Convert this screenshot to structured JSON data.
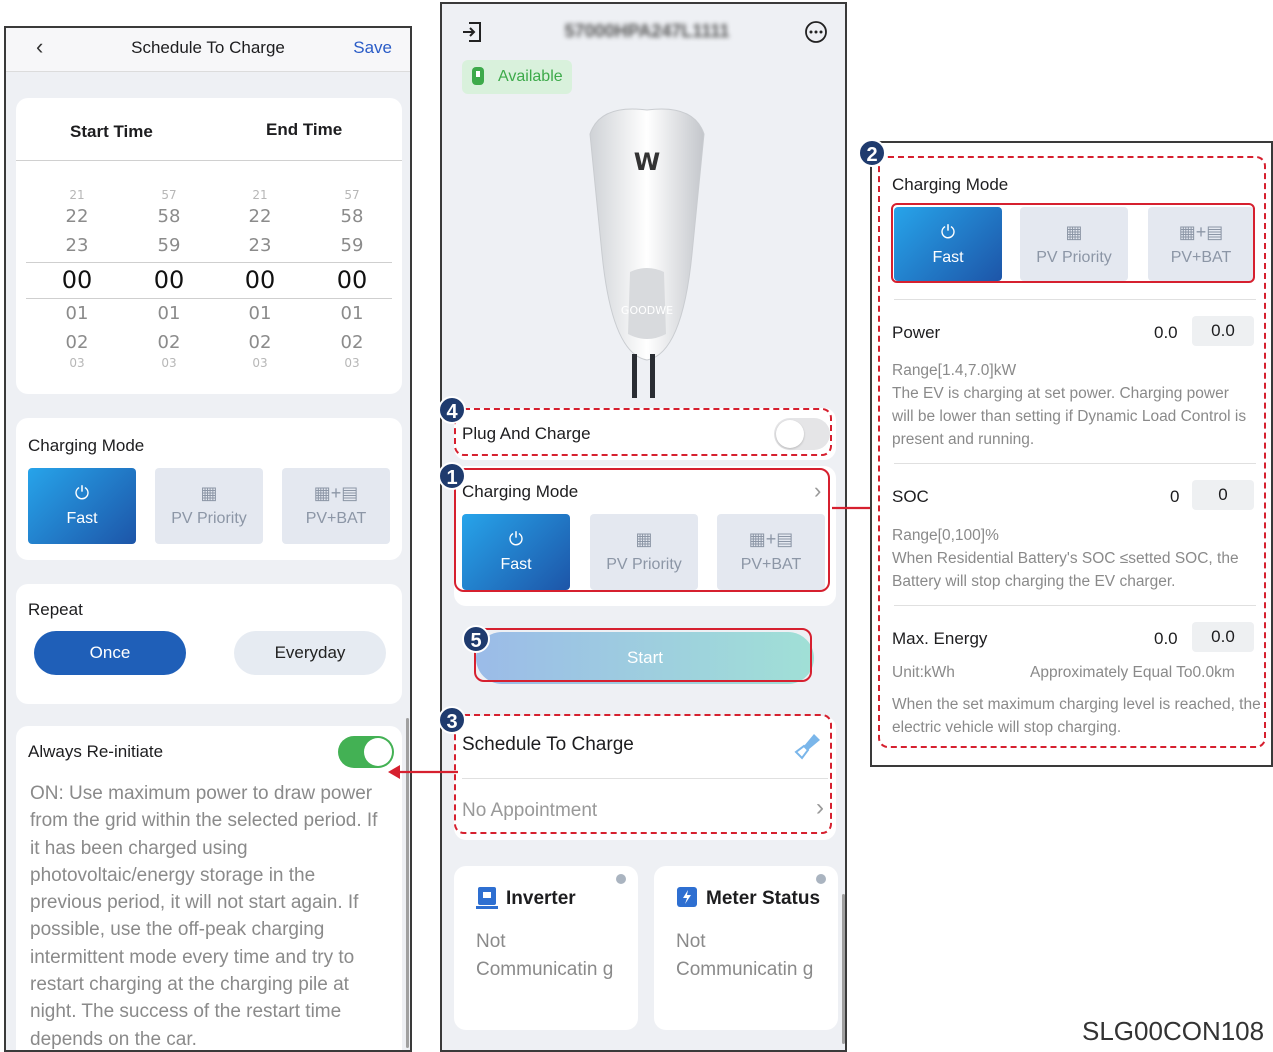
{
  "left": {
    "nav": {
      "back": "‹",
      "title": "Schedule To Charge",
      "save": "Save"
    },
    "picker": {
      "start_label": "Start Time",
      "end_label": "End Time",
      "rows_xs_top": [
        "21",
        "57",
        "21",
        "57"
      ],
      "rows_1": [
        "22",
        "58",
        "22",
        "58"
      ],
      "rows_2": [
        "23",
        "59",
        "23",
        "59"
      ],
      "selected": [
        "00",
        "00",
        "00",
        "00"
      ],
      "rows_3": [
        "01",
        "01",
        "01",
        "01"
      ],
      "rows_4": [
        "02",
        "02",
        "02",
        "02"
      ],
      "rows_xs_bottom": [
        "03",
        "03",
        "03",
        "03"
      ]
    },
    "charging_mode": {
      "title": "Charging Mode",
      "fast": "Fast",
      "pv": "PV Priority",
      "pvbat": "PV+BAT"
    },
    "repeat": {
      "title": "Repeat",
      "once": "Once",
      "everyday": "Everyday"
    },
    "reinit": {
      "title": "Always Re-initiate",
      "desc": "ON: Use maximum power to draw power from the grid within the selected period. If it has been charged using photovoltaic/energy storage in the previous period, it will not start again. If possible, use the off-peak charging intermittent mode every time and try to restart charging at the charging pile at night. The success of the restart time depends on the car."
    }
  },
  "mid": {
    "device_id": "57000HPA247L1111",
    "status": "Available",
    "brand": "GOODWE",
    "plug_and_charge": "Plug And Charge",
    "charging_mode": {
      "title": "Charging Mode",
      "fast": "Fast",
      "pv": "PV Priority",
      "pvbat": "PV+BAT"
    },
    "start": "Start",
    "schedule": {
      "title": "Schedule To Charge",
      "value": "No Appointment"
    },
    "inverter": {
      "title": "Inverter",
      "value": "Not Communicatin g"
    },
    "meter": {
      "title": "Meter Status",
      "value": "Not Communicatin g"
    }
  },
  "right": {
    "charging_mode": {
      "title": "Charging Mode",
      "fast": "Fast",
      "pv": "PV Priority",
      "pvbat": "PV+BAT"
    },
    "power": {
      "label": "Power",
      "value": "0.0",
      "input": "0.0",
      "range": "Range[1.4,7.0]kW",
      "desc": "The EV is charging at set power. Charging power will be lower than setting if Dynamic Load Control is present and running."
    },
    "soc": {
      "label": "SOC",
      "value": "0",
      "input": "0",
      "range": "Range[0,100]%",
      "desc": "When Residential Battery's SOC ≤setted SOC, the Battery will stop charging the EV charger."
    },
    "max_energy": {
      "label": "Max. Energy",
      "value": "0.0",
      "input": "0.0",
      "unit": "Unit:kWh",
      "approx": "Approximately Equal To0.0km",
      "desc": "When the set maximum charging level is reached, the electric vehicle will stop charging."
    }
  },
  "badges": [
    "1",
    "2",
    "3",
    "4",
    "5"
  ],
  "figure_code": "SLG00CON108",
  "colors": {
    "accent_blue": "#2a5cc7",
    "fast_grad_start": "#27a4ea",
    "fast_grad_end": "#1d55a8",
    "toggle_green": "#43b154",
    "annotation_red": "#d6202f",
    "status_green": "#3daa4a"
  }
}
